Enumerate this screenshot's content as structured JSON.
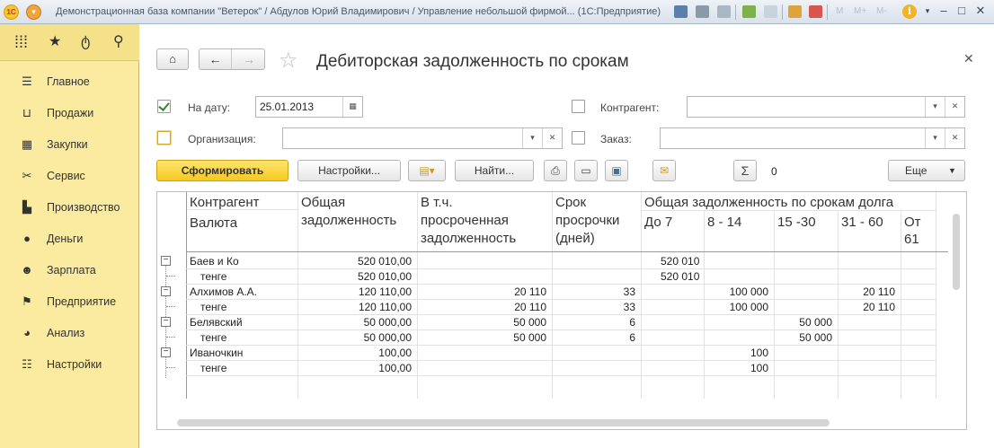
{
  "titlebar": {
    "title": "Демонстрационная база компании \"Ветерок\" / Абдулов Юрий Владимирович / Управление небольшой фирмой... (1С:Предприятие)",
    "m_labels": [
      "M",
      "M+",
      "M-"
    ]
  },
  "sidebar": {
    "items": [
      {
        "label": "Главное",
        "icon": "menu-lines-icon"
      },
      {
        "label": "Продажи",
        "icon": "basket-icon"
      },
      {
        "label": "Закупки",
        "icon": "cart-icon"
      },
      {
        "label": "Сервис",
        "icon": "tools-icon"
      },
      {
        "label": "Производство",
        "icon": "factory-icon"
      },
      {
        "label": "Деньги",
        "icon": "ruble-icon"
      },
      {
        "label": "Зарплата",
        "icon": "people-icon"
      },
      {
        "label": "Предприятие",
        "icon": "flag-icon"
      },
      {
        "label": "Анализ",
        "icon": "pie-chart-icon"
      },
      {
        "label": "Настройки",
        "icon": "settings-icon"
      }
    ]
  },
  "page": {
    "title": "Дебиторская задолженность по срокам"
  },
  "filters": {
    "date_label": "На дату:",
    "date_value": "25.01.2013",
    "date_checked": true,
    "org_label": "Организация:",
    "org_value": "",
    "counterparty_label": "Контрагент:",
    "counterparty_value": "",
    "order_label": "Заказ:",
    "order_value": ""
  },
  "toolbar": {
    "generate_label": "Сформировать",
    "settings_label": "Настройки...",
    "find_label": "Найти...",
    "sum_value": "0",
    "more_label": "Еще"
  },
  "report": {
    "header": {
      "counterparty": "Контрагент",
      "currency": "Валюта",
      "total_debt": [
        "Общая",
        "задолженность"
      ],
      "overdue_debt": [
        "В т.ч.",
        "просроченная",
        "задолженность"
      ],
      "overdue_days": [
        "Срок",
        "просрочки",
        "(дней)"
      ],
      "aging_group": "Общая задолженность по срокам долга",
      "aging_buckets": [
        "До 7",
        "8 - 14",
        "15 -30",
        "31 - 60",
        "От 61"
      ]
    },
    "rows": [
      {
        "name": "Баев и Ко",
        "currency": "тенге",
        "total": "520 010,00",
        "overdue": "",
        "days": "",
        "b1": "520 010",
        "b2": "",
        "b3": "",
        "b4": "",
        "cur_total": "520 010,00",
        "cur_overdue": "",
        "cur_days": "",
        "cur_b1": "520 010",
        "cur_b2": "",
        "cur_b3": "",
        "cur_b4": ""
      },
      {
        "name": "Алхимов А.А.",
        "currency": "тенге",
        "total": "120 110,00",
        "overdue": "20 110",
        "days": "33",
        "b1": "",
        "b2": "100 000",
        "b3": "",
        "b4": "20 110",
        "cur_total": "120 110,00",
        "cur_overdue": "20 110",
        "cur_days": "33",
        "cur_b1": "",
        "cur_b2": "100 000",
        "cur_b3": "",
        "cur_b4": "20 110"
      },
      {
        "name": "Белявский",
        "currency": "тенге",
        "total": "50 000,00",
        "overdue": "50 000",
        "days": "6",
        "b1": "",
        "b2": "",
        "b3": "50 000",
        "b4": "",
        "cur_total": "50 000,00",
        "cur_overdue": "50 000",
        "cur_days": "6",
        "cur_b1": "",
        "cur_b2": "",
        "cur_b3": "50 000",
        "cur_b4": ""
      },
      {
        "name": "Иваночкин",
        "currency": "тенге",
        "total": "100,00",
        "overdue": "",
        "days": "",
        "b1": "",
        "b2": "100",
        "b3": "",
        "b4": "",
        "cur_total": "100,00",
        "cur_overdue": "",
        "cur_days": "",
        "cur_b1": "",
        "cur_b2": "100",
        "cur_b3": "",
        "cur_b4": ""
      }
    ]
  }
}
